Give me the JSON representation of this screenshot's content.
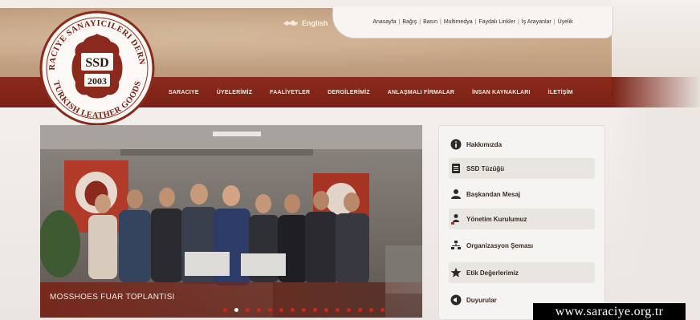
{
  "logo": {
    "arc_top": "SARACIYE SANAYICILERI DERNEGI",
    "arc_bottom": "TURKISH LEATHER GOODS",
    "abbr": "SSD",
    "year": "2003"
  },
  "header": {
    "language_label": "English",
    "top_menu": [
      "Anasayfa",
      "Bağış",
      "Basın",
      "Multimedya",
      "Faydalı Linkler",
      "İş Arayanlar",
      "Üyelik"
    ]
  },
  "nav": {
    "items": [
      "SARACIYE",
      "ÜYELERİMİZ",
      "FAALİYETLER",
      "DERGİLERİMİZ",
      "ANLAŞMALI FİRMALAR",
      "İNSAN KAYNAKLARI",
      "İLETİŞİM"
    ]
  },
  "slider": {
    "caption": "MOSSHOES FUAR TOPLANTISI",
    "dots_total": 15,
    "active_dot": 1
  },
  "side_menu": {
    "items": [
      {
        "label": "Hakkımızda",
        "icon": "info-icon"
      },
      {
        "label": "SSD Tüzüğü",
        "icon": "document-icon"
      },
      {
        "label": "Başkandan Mesaj",
        "icon": "person-icon"
      },
      {
        "label": "Yönetim Kurulumuz",
        "icon": "board-icon"
      },
      {
        "label": "Organizasyon Şeması",
        "icon": "org-chart-icon"
      },
      {
        "label": "Etik Değerlerimiz",
        "icon": "star-icon"
      },
      {
        "label": "Duyurular",
        "icon": "megaphone-icon"
      }
    ]
  },
  "watermark": "www.saraciye.org.tr",
  "colors": {
    "brand_red": "#8b2a1c",
    "header_tan": "#c9a98a",
    "dot_red": "#c8291a"
  }
}
